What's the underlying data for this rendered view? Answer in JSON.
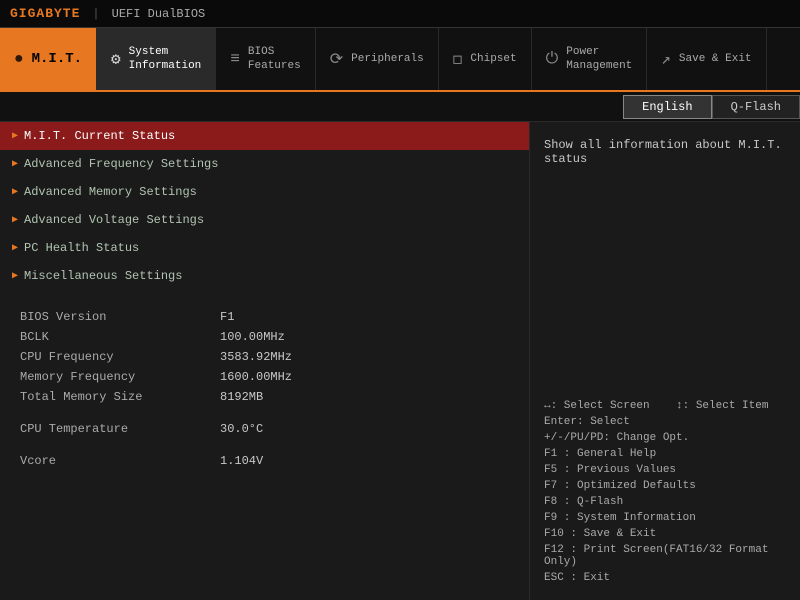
{
  "titlebar": {
    "brand": "GIGABYTE",
    "divider": "|",
    "subtitle": "UEFI DualBIOS"
  },
  "tabs": [
    {
      "id": "mit",
      "label": "M.I.T.",
      "icon": "●",
      "active": true,
      "label2": ""
    },
    {
      "id": "system",
      "label": "System",
      "label2": "Information",
      "icon": "⚙"
    },
    {
      "id": "bios",
      "label": "BIOS",
      "label2": "Features",
      "icon": "≡"
    },
    {
      "id": "peripherals",
      "label": "Peripherals",
      "label2": "",
      "icon": "⟳"
    },
    {
      "id": "chipset",
      "label": "Chipset",
      "label2": "",
      "icon": "◻"
    },
    {
      "id": "power",
      "label": "Power",
      "label2": "Management",
      "icon": "⏻"
    },
    {
      "id": "save",
      "label": "Save & Exit",
      "label2": "",
      "icon": "↗"
    }
  ],
  "langbar": {
    "english": "English",
    "qflash": "Q-Flash"
  },
  "menu": {
    "items": [
      {
        "label": "M.I.T. Current Status",
        "selected": true
      },
      {
        "label": "Advanced Frequency Settings",
        "selected": false
      },
      {
        "label": "Advanced Memory Settings",
        "selected": false
      },
      {
        "label": "Advanced Voltage Settings",
        "selected": false
      },
      {
        "label": "PC Health Status",
        "selected": false
      },
      {
        "label": "Miscellaneous Settings",
        "selected": false
      }
    ]
  },
  "info": {
    "rows": [
      {
        "label": "BIOS Version",
        "value": "F1"
      },
      {
        "label": "BCLK",
        "value": "100.00MHz"
      },
      {
        "label": "CPU Frequency",
        "value": "3583.92MHz"
      },
      {
        "label": "Memory Frequency",
        "value": "1600.00MHz"
      },
      {
        "label": "Total Memory Size",
        "value": "8192MB"
      }
    ],
    "rows2": [
      {
        "label": "CPU Temperature",
        "value": "30.0°C"
      }
    ],
    "rows3": [
      {
        "label": "Vcore",
        "value": "1.104V"
      }
    ]
  },
  "right": {
    "hint": "Show all information about M.I.T. status",
    "keys": [
      {
        "key": "↔: Select Screen",
        "sep": "  ",
        "key2": "↕: Select Item"
      },
      {
        "key": "Enter: Select",
        "sep": "",
        "key2": ""
      },
      {
        "key": "+/-/PU/PD: Change Opt.",
        "sep": "",
        "key2": ""
      },
      {
        "key": "F1   : General Help",
        "sep": "",
        "key2": ""
      },
      {
        "key": "F5   : Previous Values",
        "sep": "",
        "key2": ""
      },
      {
        "key": "F7   : Optimized Defaults",
        "sep": "",
        "key2": ""
      },
      {
        "key": "F8   : Q-Flash",
        "sep": "",
        "key2": ""
      },
      {
        "key": "F9   : System Information",
        "sep": "",
        "key2": ""
      },
      {
        "key": "F10  : Save & Exit",
        "sep": "",
        "key2": ""
      },
      {
        "key": "F12  : Print Screen(FAT16/32 Format Only)",
        "sep": "",
        "key2": ""
      },
      {
        "key": "ESC  : Exit",
        "sep": "",
        "key2": ""
      }
    ]
  }
}
